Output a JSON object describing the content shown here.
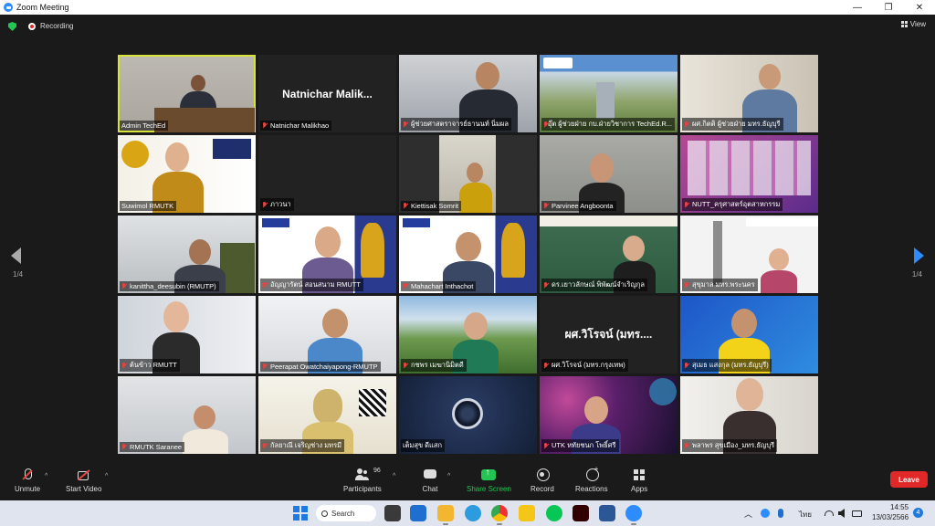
{
  "window": {
    "title": "Zoom Meeting"
  },
  "topbar": {
    "recording_label": "Recording",
    "view_label": "View"
  },
  "nav": {
    "page_left": "1/4",
    "page_right": "1/4"
  },
  "tiles": [
    {
      "name": "Admin TechEd",
      "muted": false,
      "active": true
    },
    {
      "name": "Natnichar Malikhao",
      "muted": true,
      "big_name": "Natnichar  Malik..."
    },
    {
      "name": "ผู้ช่วยศาสตราจารย์ธานนท์ นิ่มผล",
      "muted": true
    },
    {
      "name": "อุ๊ต ผู้ช่วยฝ่าย กบ.ฝ่ายวิชาการ TechEd.R...",
      "muted": true
    },
    {
      "name": "ผศ.กิตติ ผู้ช่วยฝ่าย มทร.ธัญบุรี",
      "muted": true
    },
    {
      "name": "Suwimol RMUTK",
      "muted": false
    },
    {
      "name": "ภาวนา",
      "muted": true
    },
    {
      "name": "Kiettisak Somrit",
      "muted": true
    },
    {
      "name": "Parvinee Angboonta",
      "muted": true
    },
    {
      "name": "NUTT_ครุศาสตร์อุตสาหกรรม",
      "muted": true
    },
    {
      "name": "kanittha_deesubin (RMUTP)",
      "muted": true
    },
    {
      "name": "อัญญารัตน์ สอนสนาม RMUTT",
      "muted": true
    },
    {
      "name": "Mahachart Inthachot",
      "muted": true
    },
    {
      "name": "ดร.เยาวลักษณ์ พิพัฒน์จำเริญกุล",
      "muted": true
    },
    {
      "name": "สุขุมาล มทร.พระนคร",
      "muted": true
    },
    {
      "name": "ต้นข้าว RMUTT",
      "muted": true
    },
    {
      "name": "Peerapat Owatchaiyapong-RMUTP",
      "muted": true
    },
    {
      "name": "กชพร เมฆานิมิตดี",
      "muted": true
    },
    {
      "name": "ผศ.วิโรจน์ (มทร.กรุงเทพ)",
      "muted": true,
      "big_name": "ผศ.วิโรจน์ (มทร...."
    },
    {
      "name": "สุเมธ แสงกุล (มทร.ธัญบุรี)",
      "muted": true
    },
    {
      "name": "RMUTK Saranee",
      "muted": true
    },
    {
      "name": "กัลยาณี เจริญช่าง มทรมี",
      "muted": true
    },
    {
      "name": "เต็มสุข ดีแสก",
      "muted": false
    },
    {
      "name": "UTK หทัยชนก โพธิ์ศรี",
      "muted": true
    },
    {
      "name": "พลาพร สุขเมือง_มทร.ธัญบุรี",
      "muted": true
    }
  ],
  "toolbar": {
    "unmute": "Unmute",
    "start_video": "Start Video",
    "participants": "Participants",
    "participants_count": "96",
    "chat": "Chat",
    "share_screen": "Share Screen",
    "record": "Record",
    "reactions": "Reactions",
    "apps": "Apps",
    "leave": "Leave"
  },
  "taskbar": {
    "search": "Search",
    "lang": "ไทย",
    "time": "14:55",
    "date": "13/03/2566",
    "notifications": "4"
  },
  "colors": {
    "accent": "#2d8cff",
    "active_speaker": "#d7e23a",
    "leave": "#e02828",
    "share": "#23c552"
  }
}
